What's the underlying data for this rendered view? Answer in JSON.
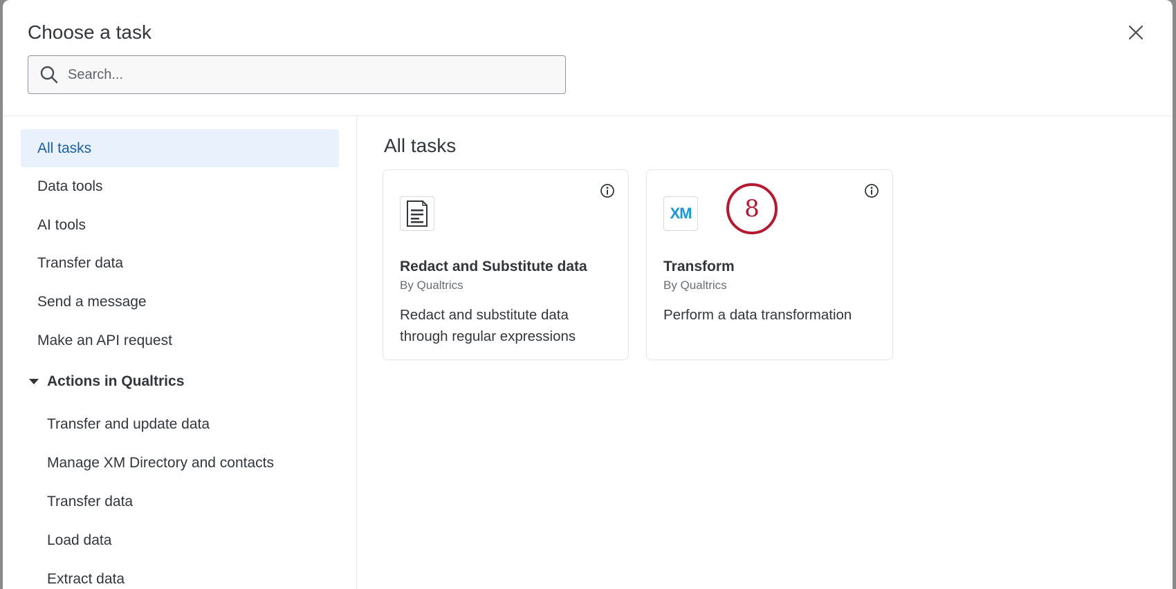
{
  "dialog": {
    "title": "Choose a task",
    "close_icon": "close-icon"
  },
  "search": {
    "placeholder": "Search...",
    "value": "",
    "icon": "search-icon"
  },
  "sidebar": {
    "items": [
      {
        "label": "All tasks",
        "active": true
      },
      {
        "label": "Data tools"
      },
      {
        "label": "AI tools"
      },
      {
        "label": "Transfer data"
      },
      {
        "label": "Send a message"
      },
      {
        "label": "Make an API request"
      }
    ],
    "section": {
      "label": "Actions in Qualtrics",
      "expanded": true,
      "items": [
        {
          "label": "Transfer and update data"
        },
        {
          "label": "Manage XM Directory and contacts"
        },
        {
          "label": "Transfer data"
        },
        {
          "label": "Load data"
        },
        {
          "label": "Extract data"
        }
      ]
    }
  },
  "main": {
    "title": "All tasks",
    "cards": [
      {
        "name": "Redact and Substitute data",
        "by": "By Qualtrics",
        "description": "Redact and substitute data through regular expressions",
        "icon": "document-icon"
      },
      {
        "name": "Transform",
        "by": "By Qualtrics",
        "description": "Perform a data transformation",
        "icon": "xm-logo-icon",
        "logo_text": "XM"
      }
    ]
  },
  "annotation": {
    "step_number": "8",
    "color": "#b8182f"
  },
  "colors": {
    "active_bg": "#e8f1fc",
    "active_text": "#1b5fa8",
    "text": "#32363a"
  }
}
